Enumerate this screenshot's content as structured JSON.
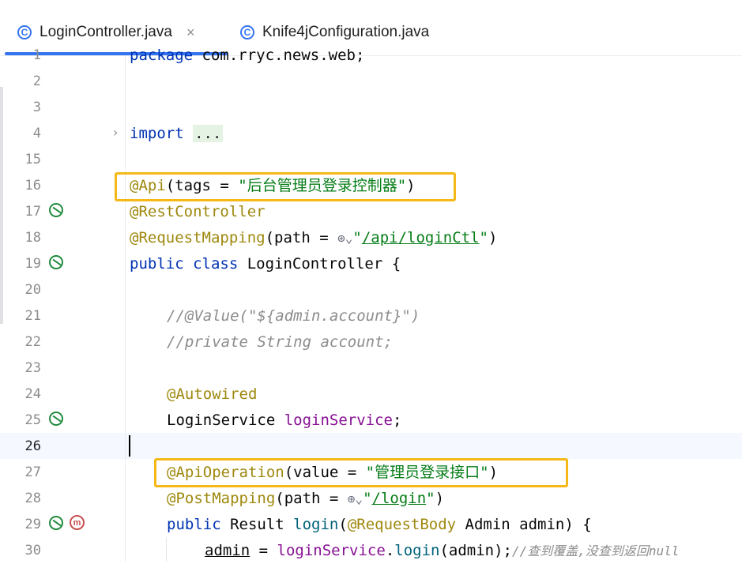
{
  "tabs": [
    {
      "icon": "class-icon",
      "label": "LoginController.java",
      "close": "×",
      "active": true
    },
    {
      "icon": "class-icon",
      "label": "Knife4jConfiguration.java",
      "active": false
    }
  ],
  "tab_icon_glyph": "C",
  "gutter_icon_marker": "m",
  "line_numbers": [
    "1",
    "2",
    "3",
    "4",
    "15",
    "16",
    "17",
    "18",
    "19",
    "20",
    "21",
    "22",
    "23",
    "24",
    "25",
    "26",
    "27",
    "28",
    "29",
    "30"
  ],
  "current_line": "26",
  "code": {
    "l1_kw": "package",
    "l1_rest": " com.rryc.news.web;",
    "l4_kw": "import",
    "l4_folded": "...",
    "l16_an": "@Api",
    "l16_pre": "(tags = ",
    "l16_str": "\"后台管理员登录控制器\"",
    "l16_post": ")",
    "l17_an": "@RestController",
    "l18_an": "@RequestMapping",
    "l18_pre": "(path = ",
    "l18_q1": "\"",
    "l18_url": "/api/loginCtl",
    "l18_q2": "\"",
    "l18_post": ")",
    "l19_kw": "public class",
    "l19_rest": " LoginController {",
    "l21_cm": "//@Value(\"${admin.account}\")",
    "l22_cm": "//private String account;",
    "l24_an": "@Autowired",
    "l25_type": "LoginService ",
    "l25_field": "loginService",
    "l25_end": ";",
    "l27_an": "@ApiOperation",
    "l27_pre": "(value = ",
    "l27_str": "\"管理员登录接口\"",
    "l27_post": ")",
    "l28_an": "@PostMapping",
    "l28_pre": "(path = ",
    "l28_q1": "\"",
    "l28_url": "/login",
    "l28_q2": "\"",
    "l28_post": ")",
    "l29_kw": "public",
    "l29_type": " Result ",
    "l29_method": "login",
    "l29_paren": "(",
    "l29_an": "@RequestBody",
    "l29_rest": " Admin admin) {",
    "l30_var": "admin",
    "l30_eq": " = ",
    "l30_field": "loginService",
    "l30_dot": ".",
    "l30_method": "login",
    "l30_args": "(admin);",
    "l30_cm": "//查到覆盖,没查到返回null"
  },
  "colors": {
    "accent": "#3574f0",
    "highlight_box": "#f5b816",
    "keyword": "#0033b3",
    "annotation": "#9e880d",
    "string": "#067d17",
    "comment": "#8c8c8c",
    "field": "#871094"
  }
}
